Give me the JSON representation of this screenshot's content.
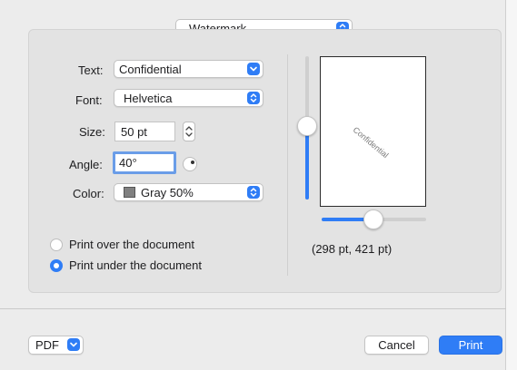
{
  "dialog": {
    "section_popup": "Watermark",
    "fields": {
      "text_label": "Text:",
      "text_value": "Confidential",
      "font_label": "Font:",
      "font_value": "Helvetica",
      "size_label": "Size:",
      "size_value": "50 pt",
      "angle_label": "Angle:",
      "angle_value": "40°",
      "color_label": "Color:",
      "color_value": "Gray 50%",
      "color_swatch": "#808080"
    },
    "placement": {
      "option_over": "Print over the document",
      "option_under": "Print under the document",
      "selected": "Print under the document"
    },
    "preview": {
      "watermark_text": "Confidential",
      "position_readout": "(298 pt, 421 pt)"
    },
    "opacity_slider_level": 0.5,
    "scale_slider_level": 0.49
  },
  "footer": {
    "pdf_label": "PDF",
    "cancel_label": "Cancel",
    "print_label": "Print"
  },
  "colors": {
    "accent": "#2f7df6"
  }
}
